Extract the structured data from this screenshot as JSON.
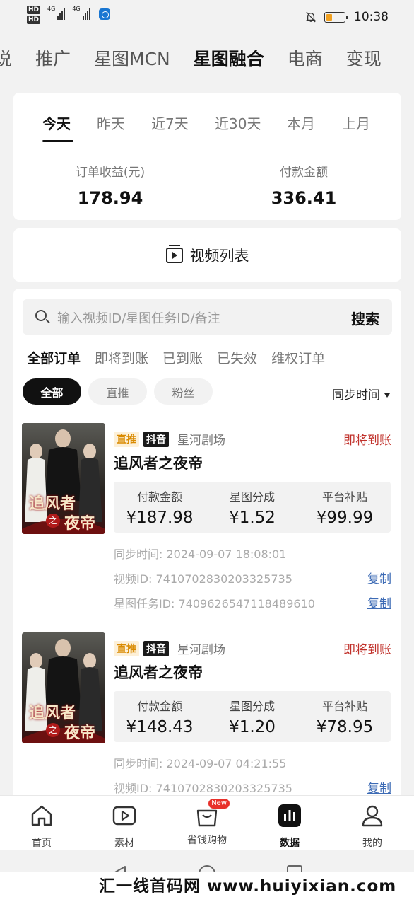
{
  "status_bar": {
    "hd1": "HD",
    "hd2": "HD",
    "net1": "4G",
    "net2": "4G",
    "time": "10:38"
  },
  "top_tabs": [
    {
      "label": "说",
      "active": false
    },
    {
      "label": "推广",
      "active": false
    },
    {
      "label": "星图MCN",
      "active": false
    },
    {
      "label": "星图融合",
      "active": true
    },
    {
      "label": "电商",
      "active": false
    },
    {
      "label": "变现",
      "active": false
    }
  ],
  "date_tabs": [
    {
      "label": "今天",
      "active": true
    },
    {
      "label": "昨天",
      "active": false
    },
    {
      "label": "近7天",
      "active": false
    },
    {
      "label": "近30天",
      "active": false
    },
    {
      "label": "本月",
      "active": false
    },
    {
      "label": "上月",
      "active": false
    }
  ],
  "stats": {
    "order_income_label": "订单收益(元)",
    "order_income_value": "178.94",
    "payment_label": "付款金额",
    "payment_value": "336.41"
  },
  "video_list_label": "视频列表",
  "search": {
    "placeholder": "输入视频ID/星图任务ID/备注",
    "button": "搜索"
  },
  "order_tabs": [
    {
      "label": "全部订单",
      "active": true
    },
    {
      "label": "即将到账",
      "active": false
    },
    {
      "label": "已到账",
      "active": false
    },
    {
      "label": "已失效",
      "active": false
    },
    {
      "label": "维权订单",
      "active": false
    }
  ],
  "filter_pills": [
    {
      "label": "全部",
      "active": true
    },
    {
      "label": "直推",
      "active": false
    },
    {
      "label": "粉丝",
      "active": false
    }
  ],
  "sync_sort_label": "同步时间",
  "orders": [
    {
      "tag_type": "直推",
      "tag_platform": "抖音",
      "theater": "星河剧场",
      "status": "即将到账",
      "title": "追风者之夜帝",
      "poster_text_1": "追风者",
      "poster_text_2": "之",
      "poster_text_3": "夜帝",
      "pay_label": "付款金额",
      "pay_value": "¥187.98",
      "share_label": "星图分成",
      "share_value": "¥1.52",
      "subsidy_label": "平台补贴",
      "subsidy_value": "¥99.99",
      "sync_time": "同步时间:  2024-09-07 18:08:01",
      "video_id": "视频ID:  7410702830203325735",
      "task_id": "星图任务ID:  7409626547118489610",
      "copy_label": "复制"
    },
    {
      "tag_type": "直推",
      "tag_platform": "抖音",
      "theater": "星河剧场",
      "status": "即将到账",
      "title": "追风者之夜帝",
      "poster_text_1": "追风者",
      "poster_text_2": "之",
      "poster_text_3": "夜帝",
      "pay_label": "付款金额",
      "pay_value": "¥148.43",
      "share_label": "星图分成",
      "share_value": "¥1.20",
      "subsidy_label": "平台补贴",
      "subsidy_value": "¥78.95",
      "sync_time": "同步时间:  2024-09-07 04:21:55",
      "video_id": "视频ID:  7410702830203325735",
      "copy_label": "复制"
    }
  ],
  "bottom_nav": [
    {
      "label": "首页",
      "icon": "home-icon",
      "active": false
    },
    {
      "label": "素材",
      "icon": "play-icon",
      "active": false
    },
    {
      "label": "省钱购物",
      "icon": "shopping-bag-icon",
      "active": false,
      "badge": "New"
    },
    {
      "label": "数据",
      "icon": "chart-icon",
      "active": true
    },
    {
      "label": "我的",
      "icon": "user-icon",
      "active": false
    }
  ],
  "watermark": "汇一线首码网 www.huiyixian.com",
  "colors": {
    "status_red": "#c0302a",
    "tag_orange": "#d98a00",
    "link_blue": "#3d6bb5",
    "badge_red": "#e8302a"
  }
}
